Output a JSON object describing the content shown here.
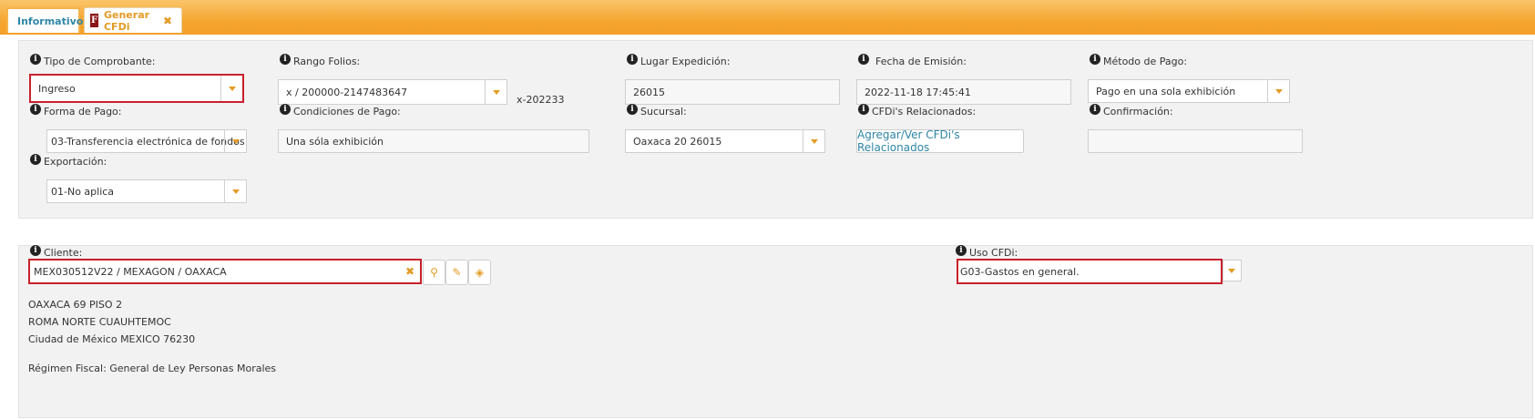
{
  "tabs": [
    {
      "label": "Informativo"
    },
    {
      "label": "Generar CFDi",
      "icon_letter": "F"
    }
  ],
  "tipo_comprobante": {
    "label": "Tipo de Comprobante:",
    "value": "Ingreso"
  },
  "rango_folios": {
    "label": "Rango Folios:",
    "value": "x / 200000-2147483647",
    "note": "x-202233"
  },
  "lugar_expedicion": {
    "label": "Lugar Expedición:",
    "value": "26015"
  },
  "fecha_emision": {
    "label": "Fecha de Emisión:",
    "value": "2022-11-18 17:45:41"
  },
  "metodo_pago": {
    "label": "Método de Pago:",
    "value": "Pago en una sola exhibición"
  },
  "forma_pago": {
    "label": "Forma de Pago:",
    "value": "03-Transferencia electrónica de fondos"
  },
  "condiciones_pago": {
    "label": "Condiciones de Pago:",
    "value": "Una sóla exhibición"
  },
  "sucursal": {
    "label": "Sucursal:",
    "value": "Oaxaca 20 26015"
  },
  "cfdis_relacionados": {
    "label": "CFDi's Relacionados:",
    "button": "Agregar/Ver CFDi's Relacionados"
  },
  "confirmacion": {
    "label": "Confirmación:",
    "value": ""
  },
  "exportacion": {
    "label": "Exportación:",
    "value": "01-No aplica"
  },
  "cliente": {
    "label": "Cliente:",
    "value": "MEX030512V22 / MEXAGON / OAXACA",
    "address": [
      "OAXACA 69 PISO 2",
      "ROMA NORTE CUAUHTEMOC",
      "Ciudad de México MEXICO 76230"
    ],
    "regimen": "Régimen Fiscal: General de Ley Personas Morales"
  },
  "uso_cfdi": {
    "label": "Uso CFDi:",
    "value": "G03-Gastos en general."
  },
  "colors": {
    "accent": "#f5a630",
    "link": "#2f86a6",
    "highlight": "#c8202c"
  }
}
